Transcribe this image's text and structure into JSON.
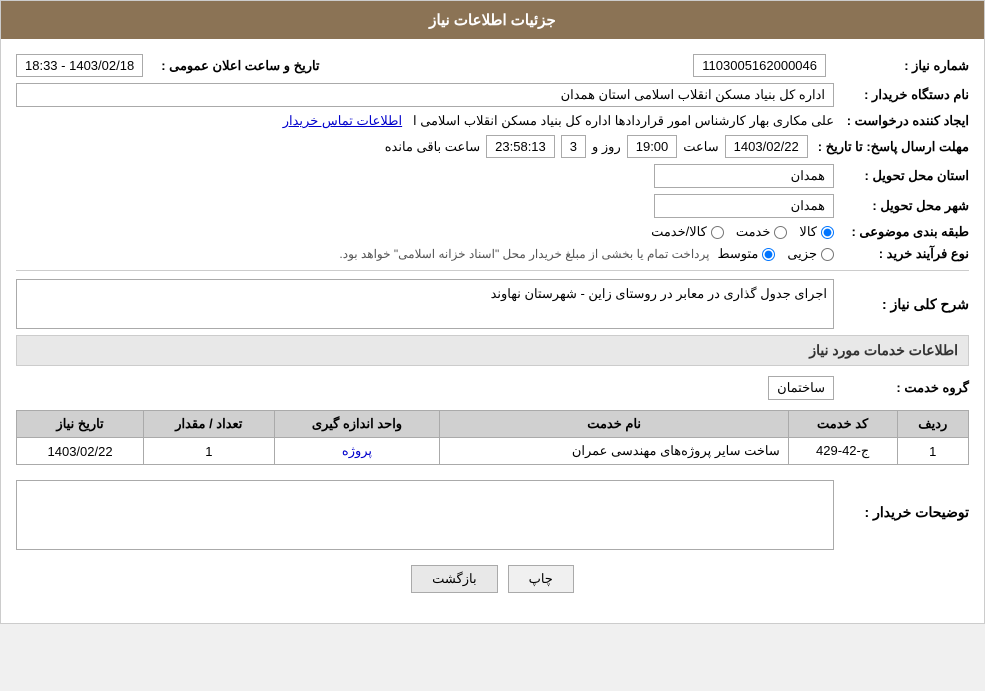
{
  "header": {
    "title": "جزئیات اطلاعات نیاز"
  },
  "form": {
    "shomareNiaz_label": "شماره نیاز :",
    "shomareNiaz_value": "1103005162000046",
    "namDasgah_label": "نام دستگاه خریدار :",
    "namDasgah_value": "اداره کل بنیاد مسکن انقلاب اسلامی استان همدان",
    "ejadKonande_label": "ایجاد کننده درخواست :",
    "ejadKonande_value": "علی مکاری بهار کارشناس امور قراردادها اداره کل بنیاد مسکن انقلاب اسلامی ا",
    "ejadKonande_link": "اطلاعات تماس خریدار",
    "mohlatErsalPasox_label": "مهلت ارسال پاسخ: تا تاریخ :",
    "tarikhAelan_label": "تاریخ و ساعت اعلان عمومی :",
    "tarikhAelan_value": "1403/02/18 - 18:33",
    "tarikhPasox": "1403/02/22",
    "saatPasox": "19:00",
    "roz": "3",
    "mande": "23:58:13",
    "ostanTahvil_label": "استان محل تحویل :",
    "ostanTahvil_value": "همدان",
    "shahrTahvil_label": "شهر محل تحویل :",
    "shahrTahvil_value": "همدان",
    "tabaqeBandi_label": "طبقه بندی موضوعی :",
    "tabaqeBandi_options": [
      "کالا",
      "خدمت",
      "کالا/خدمت"
    ],
    "tabaqeBandi_selected": "کالا",
    "noeFarayandKharid_label": "نوع فرآیند خرید :",
    "noeFarayandKharid_options": [
      "جزیی",
      "متوسط"
    ],
    "noeFarayandKharid_selected": "متوسط",
    "noeFarayandKharid_note": "پرداخت تمام یا بخشی از مبلغ خریدار محل \"اسناد خزانه اسلامی\" خواهد بود.",
    "sharhKolli_label": "شرح کلی نیاز :",
    "sharhKolli_value": "اجرای جدول گذاری در معابر در روستای زاین - شهرستان نهاوند",
    "khadamat_label": "اطلاعات خدمات مورد نیاز",
    "grohKhadamat_label": "گروه خدمت :",
    "grohKhadamat_value": "ساختمان",
    "services_cols": {
      "radif": "ردیف",
      "kodKhadamat": "کد خدمت",
      "namKhadamat": "نام خدمت",
      "vahedAndaze": "واحد اندازه گیری",
      "tedadMeqdar": "تعداد / مقدار",
      "tarikhNiaz": "تاریخ نیاز"
    },
    "services_rows": [
      {
        "radif": "1",
        "kodKhadamat": "ج-42-429",
        "namKhadamat": "ساخت سایر پروژه‌های مهندسی عمران",
        "vahedAndaze": "پروژه",
        "tedadMeqdar": "1",
        "tarikhNiaz": "1403/02/22"
      }
    ],
    "tawzihaat_label": "توضیحات خریدار :",
    "btn_print": "چاپ",
    "btn_back": "بازگشت"
  }
}
